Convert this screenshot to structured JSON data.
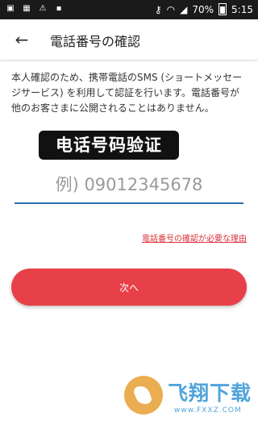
{
  "status_bar": {
    "battery": "70%",
    "time": "5:15",
    "left_icons": [
      "sim-icon",
      "image-icon",
      "warning-icon",
      "notification-icon"
    ],
    "right_icons": [
      "key-icon",
      "wifi-icon",
      "signal-icon",
      "battery-icon"
    ]
  },
  "app_bar": {
    "back_icon": "arrow-left-icon",
    "title": "電話番号の確認"
  },
  "description": "本人確認のため、携帯電話のSMS (ショートメッセージサービス) を利用して認証を行います。電話番号が他のお客さまに公開されることはありません。",
  "overlay": {
    "caption": "电话号码验证"
  },
  "phone_input": {
    "placeholder": "例) 09012345678",
    "value": ""
  },
  "reason_link": {
    "label": "電話番号の確認が必要な理由"
  },
  "next_button": {
    "label": "次へ"
  },
  "watermark": {
    "text": "飞翔下载",
    "url": "www.FXXZ.COM"
  },
  "colors": {
    "accent": "#e84048",
    "link": "#d8323a",
    "input_underline": "#2a6fb0",
    "status_bar": "#1a1a1a"
  }
}
